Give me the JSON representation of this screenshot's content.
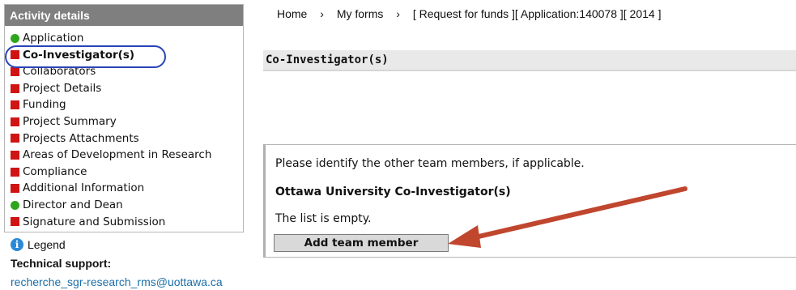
{
  "sidebar": {
    "header": "Activity details",
    "items": [
      {
        "label": "Application",
        "status": "green"
      },
      {
        "label": "Co-Investigator(s)",
        "status": "red",
        "active": true
      },
      {
        "label": "Collaborators",
        "status": "red"
      },
      {
        "label": "Project Details",
        "status": "red"
      },
      {
        "label": "Funding",
        "status": "red"
      },
      {
        "label": "Project Summary",
        "status": "red"
      },
      {
        "label": "Projects Attachments",
        "status": "red"
      },
      {
        "label": "Areas of Development in Research",
        "status": "red"
      },
      {
        "label": "Compliance",
        "status": "red"
      },
      {
        "label": "Additional Information",
        "status": "red"
      },
      {
        "label": "Director and Dean",
        "status": "green"
      },
      {
        "label": "Signature and Submission",
        "status": "red"
      }
    ]
  },
  "legend": {
    "label": "Legend",
    "icon": "info-icon"
  },
  "support": {
    "title": "Technical support:",
    "email": "recherche_sgr-research_rms@uottawa.ca"
  },
  "breadcrumb": {
    "home": "Home",
    "my_forms": "My forms",
    "current": "[ Request for funds ][ Application:140078 ][ 2014 ]",
    "separator": "›"
  },
  "section": {
    "title": "Co-Investigator(s)"
  },
  "panel": {
    "intro": "Please identify the other team members, if applicable.",
    "subtitle": "Ottawa University Co-Investigator(s)",
    "empty_message": "The list is empty.",
    "add_button": "Add team member"
  },
  "colors": {
    "status_red": "#d01414",
    "status_green": "#2fa51d",
    "highlight_ellipse": "#2843b8",
    "annotation_arrow": "#c0462e",
    "sidebar_header": "#7f7f7f"
  }
}
